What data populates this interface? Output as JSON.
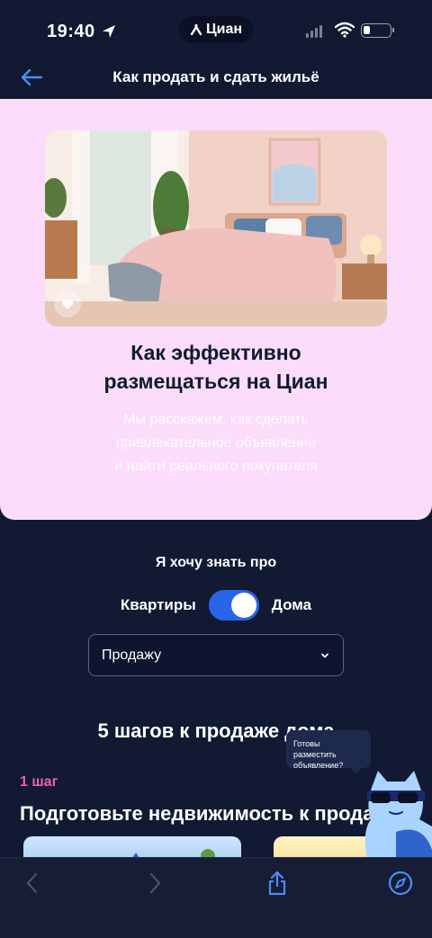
{
  "status_bar": {
    "time": "19:40",
    "carrier_pill": "Циан",
    "battery_level": 0.25
  },
  "header": {
    "title": "Как продать и сдать жильё"
  },
  "hero": {
    "title_line1": "Как эффективно",
    "title_line2": "размещаться на Циан",
    "subtitle_line1": "Мы расскажем, как сделать",
    "subtitle_line2": "привлекательное объявление",
    "subtitle_line3": "и найти реального покупателя"
  },
  "filters": {
    "want_label": "Я хочу знать про",
    "toggle_left": "Квартиры",
    "toggle_right": "Дома",
    "toggle_on": true,
    "select_value": "Продажу"
  },
  "steps": {
    "heading": "5 шагов к продаже дома",
    "step_number": "1 шаг",
    "step_title": "Подготовьте недвижимость к продаже"
  },
  "assistant": {
    "tooltip_line1": "Готовы разместить",
    "tooltip_line2": "объявление?"
  },
  "colors": {
    "background": "#121a33",
    "hero_bg": "#fbdcfb",
    "accent": "#2766e9",
    "step_accent": "#f05fb0"
  },
  "icons": {
    "back": "arrow-left-icon",
    "like": "heart-icon",
    "select": "chevron-down-icon",
    "browser_back": "chevron-left-icon",
    "browser_forward": "chevron-right-icon",
    "share": "share-icon",
    "compass": "compass-icon"
  }
}
